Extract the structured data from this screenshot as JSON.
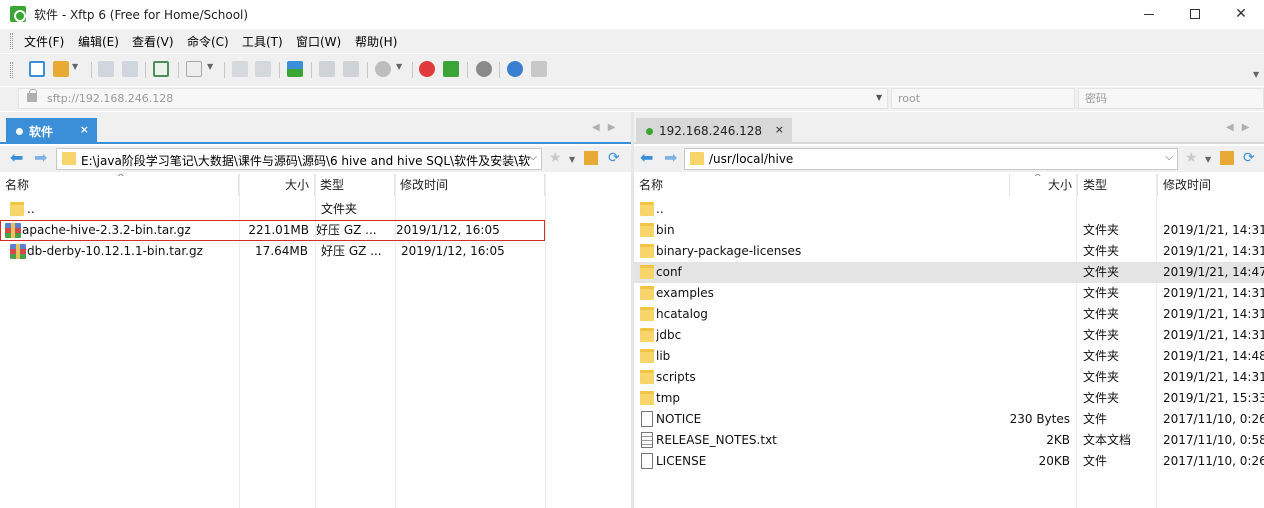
{
  "window": {
    "title": "软件 - Xftp 6 (Free for Home/School)",
    "controls": {
      "minimize": "",
      "maximize": "",
      "close": "✕"
    }
  },
  "menu": [
    "文件(F)",
    "编辑(E)",
    "查看(V)",
    "命令(C)",
    "工具(T)",
    "窗口(W)",
    "帮助(H)"
  ],
  "toolbar": {
    "icons": [
      "new-session-icon",
      "open-folder-icon",
      "connect-icon",
      "disconnect-icon",
      "new-window-icon",
      "screen-icon",
      "copy-icon",
      "paste-icon",
      "transfer-icon",
      "page-icon",
      "page-icon-2",
      "stop-icon",
      "xshell-icon",
      "xftp-icon",
      "settings-icon",
      "help-icon",
      "chat-icon"
    ],
    "colors": {
      "accent": "#3a8fd8",
      "xshell": "#e0383b",
      "xftp": "#3aa535"
    }
  },
  "address": {
    "host": "sftp://192.168.246.128",
    "user_placeholder": "root",
    "password_placeholder": "密码"
  },
  "left_pane": {
    "tab_label": "软件",
    "tab_close": "×",
    "path": "E:\\java阶段学习笔记\\大数据\\课件与源码\\源码\\6 hive and hive SQL\\软件及安装\\软",
    "columns": [
      "名称",
      "大小",
      "类型",
      "修改时间"
    ],
    "rows": [
      {
        "name": "..",
        "size": "",
        "type": "文件夹",
        "modified": "",
        "icon": "folder-icon"
      },
      {
        "name": "apache-hive-2.3.2-bin.tar.gz",
        "size": "221.01MB",
        "type": "好压 GZ ...",
        "modified": "2019/1/12, 16:05",
        "icon": "archive-icon"
      },
      {
        "name": "db-derby-10.12.1.1-bin.tar.gz",
        "size": "17.64MB",
        "type": "好压 GZ ...",
        "modified": "2019/1/12, 16:05",
        "icon": "archive-icon"
      }
    ]
  },
  "right_pane": {
    "tab_label": "192.168.246.128",
    "tab_close": "×",
    "path": "/usr/local/hive",
    "columns": [
      "名称",
      "大小",
      "类型",
      "修改时间"
    ],
    "rows": [
      {
        "name": "..",
        "size": "",
        "type": "",
        "modified": "",
        "icon": "folder-icon"
      },
      {
        "name": "bin",
        "size": "",
        "type": "文件夹",
        "modified": "2019/1/21, 14:31",
        "icon": "folder-icon"
      },
      {
        "name": "binary-package-licenses",
        "size": "",
        "type": "文件夹",
        "modified": "2019/1/21, 14:31",
        "icon": "folder-icon"
      },
      {
        "name": "conf",
        "size": "",
        "type": "文件夹",
        "modified": "2019/1/21, 14:47",
        "icon": "folder-icon"
      },
      {
        "name": "examples",
        "size": "",
        "type": "文件夹",
        "modified": "2019/1/21, 14:31",
        "icon": "folder-icon"
      },
      {
        "name": "hcatalog",
        "size": "",
        "type": "文件夹",
        "modified": "2019/1/21, 14:31",
        "icon": "folder-icon"
      },
      {
        "name": "jdbc",
        "size": "",
        "type": "文件夹",
        "modified": "2019/1/21, 14:31",
        "icon": "folder-icon"
      },
      {
        "name": "lib",
        "size": "",
        "type": "文件夹",
        "modified": "2019/1/21, 14:48",
        "icon": "folder-icon"
      },
      {
        "name": "scripts",
        "size": "",
        "type": "文件夹",
        "modified": "2019/1/21, 14:31",
        "icon": "folder-icon"
      },
      {
        "name": "tmp",
        "size": "",
        "type": "文件夹",
        "modified": "2019/1/21, 15:33",
        "icon": "folder-icon"
      },
      {
        "name": "NOTICE",
        "size": "230 Bytes",
        "type": "文件",
        "modified": "2017/11/10, 0:26",
        "icon": "file-icon"
      },
      {
        "name": "RELEASE_NOTES.txt",
        "size": "2KB",
        "type": "文本文档",
        "modified": "2017/11/10, 0:58",
        "icon": "text-doc-icon"
      },
      {
        "name": "LICENSE",
        "size": "20KB",
        "type": "文件",
        "modified": "2017/11/10, 0:26",
        "icon": "file-icon"
      }
    ]
  }
}
